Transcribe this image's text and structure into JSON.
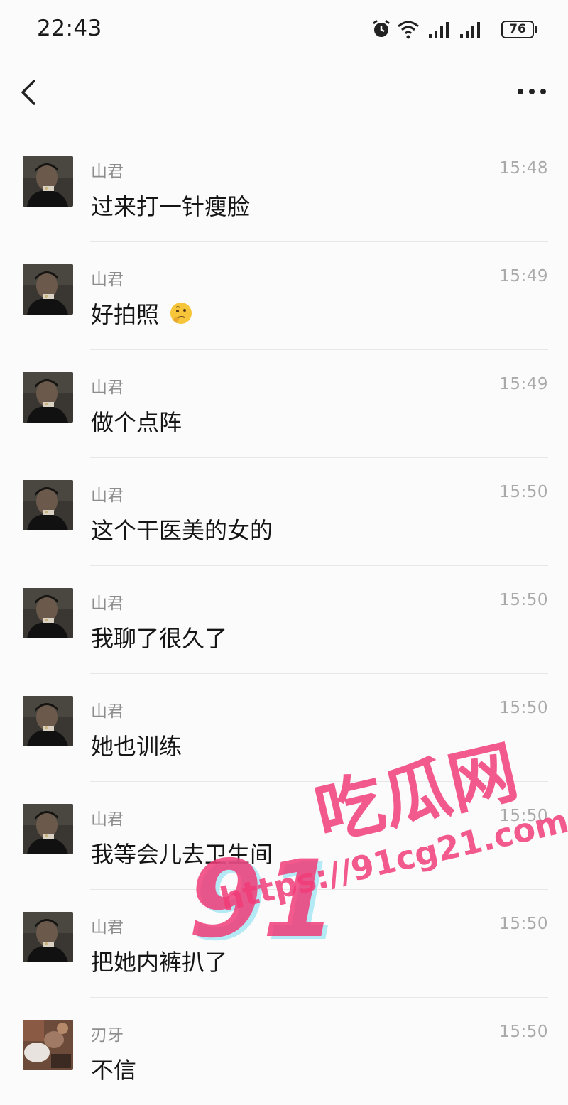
{
  "status_bar": {
    "time": "22:43",
    "battery": "76"
  },
  "colors": {
    "background": "#fbfbfb",
    "divider": "#e6e6e6",
    "watermark": "#f03c78"
  },
  "messages": [
    {
      "sender": "山君",
      "time": "15:48",
      "text": "过来打一针瘦脸",
      "avatar": "avatar-man"
    },
    {
      "sender": "山君",
      "time": "15:49",
      "text": "好拍照",
      "emoji": "thinking-face-emoji",
      "avatar": "avatar-man"
    },
    {
      "sender": "山君",
      "time": "15:49",
      "text": "做个点阵",
      "avatar": "avatar-man"
    },
    {
      "sender": "山君",
      "time": "15:50",
      "text": "这个干医美的女的",
      "avatar": "avatar-man"
    },
    {
      "sender": "山君",
      "time": "15:50",
      "text": "我聊了很久了",
      "avatar": "avatar-man"
    },
    {
      "sender": "山君",
      "time": "15:50",
      "text": "她也训练",
      "avatar": "avatar-man"
    },
    {
      "sender": "山君",
      "time": "15:50",
      "text": "我等会儿去卫生间",
      "avatar": "avatar-man"
    },
    {
      "sender": "山君",
      "time": "15:50",
      "text": "把她内裤扒了",
      "avatar": "avatar-man"
    },
    {
      "sender": "刃牙",
      "time": "15:50",
      "text": "不信",
      "avatar": "avatar-photo"
    }
  ],
  "watermark": {
    "number": "91",
    "brand": "吃瓜网",
    "url": "https://91cg21.com"
  }
}
